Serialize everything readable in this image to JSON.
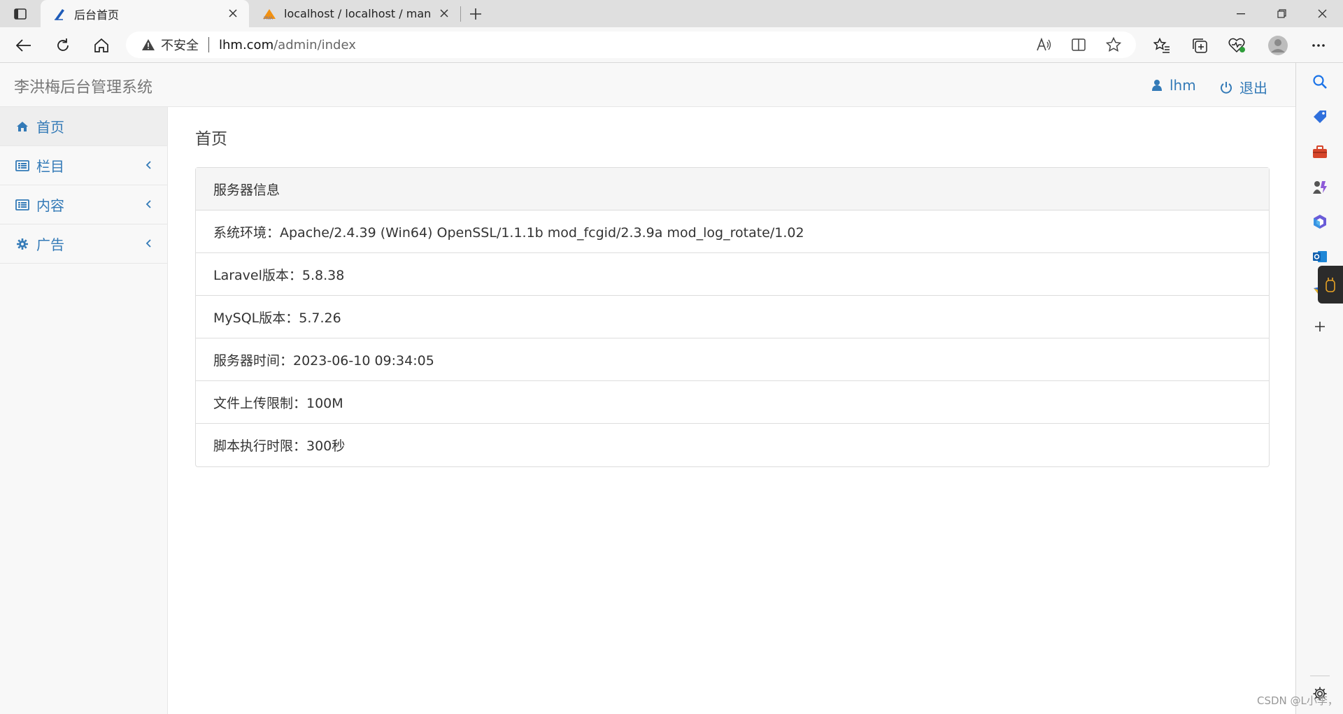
{
  "browser": {
    "tabs": [
      {
        "title": "后台首页",
        "active": true
      },
      {
        "title": "localhost / localhost / mana | php",
        "active": false
      }
    ],
    "address": {
      "security_label": "不安全",
      "url_host": "lhm.com",
      "url_path": "/admin/index"
    }
  },
  "app": {
    "brand": "李洪梅后台管理系统",
    "header": {
      "user_label": "lhm",
      "logout_label": "退出"
    },
    "sidebar": {
      "items": [
        {
          "label": "首页",
          "icon": "home-icon",
          "active": true
        },
        {
          "label": "栏目",
          "icon": "list-icon",
          "active": false
        },
        {
          "label": "内容",
          "icon": "list-icon",
          "active": false
        },
        {
          "label": "广告",
          "icon": "gear-icon",
          "active": false
        }
      ]
    },
    "main": {
      "title": "首页",
      "panel": {
        "heading": "服务器信息",
        "rows": [
          "系统环境：Apache/2.4.39 (Win64) OpenSSL/1.1.1b mod_fcgid/2.3.9a mod_log_rotate/1.02",
          "Laravel版本：5.8.38",
          "MySQL版本：5.7.26",
          "服务器时间：2023-06-10 09:34:05",
          "文件上传限制：100M",
          "脚本执行时限：300秒"
        ]
      }
    }
  },
  "watermark": "CSDN @L小李，",
  "colors": {
    "link": "#337ab7",
    "brand_text": "#777777",
    "header_bg": "#f8f8f8"
  }
}
